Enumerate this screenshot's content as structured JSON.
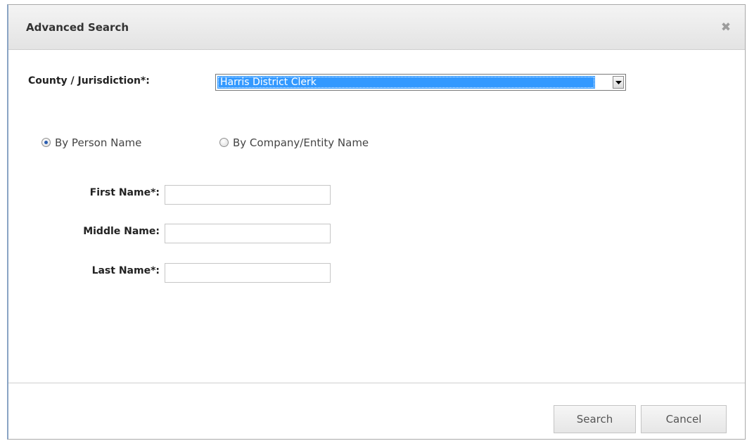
{
  "dialog": {
    "title": "Advanced Search",
    "close_icon": "close-icon"
  },
  "county": {
    "label": "County / Jurisdiction*:",
    "selected": "Harris District Clerk"
  },
  "search_type": {
    "options": [
      {
        "label": "By Person Name",
        "checked": true
      },
      {
        "label": "By Company/Entity Name",
        "checked": false
      }
    ]
  },
  "fields": {
    "first_name": {
      "label": "First Name*:",
      "value": ""
    },
    "middle_name": {
      "label": "Middle Name:",
      "value": ""
    },
    "last_name": {
      "label": "Last Name*:",
      "value": ""
    }
  },
  "buttons": {
    "search": "Search",
    "cancel": "Cancel"
  },
  "colors": {
    "selection": "#3399ff",
    "title_text": "#333333"
  }
}
